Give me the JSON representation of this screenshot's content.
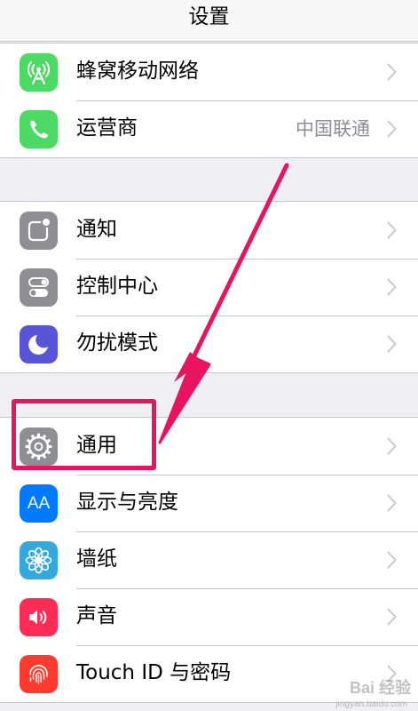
{
  "navbar": {
    "title": "设置"
  },
  "groups": [
    {
      "items": [
        {
          "label": "蜂窝移动网络",
          "icon": "cellular-antenna-icon",
          "icon_color": "#4cd964",
          "value": ""
        },
        {
          "label": "运营商",
          "icon": "phone-icon",
          "icon_color": "#4cd964",
          "value": "中国联通"
        }
      ]
    },
    {
      "items": [
        {
          "label": "通知",
          "icon": "notifications-icon",
          "icon_color": "#8e8e93",
          "value": ""
        },
        {
          "label": "控制中心",
          "icon": "control-center-icon",
          "icon_color": "#8e8e93",
          "value": ""
        },
        {
          "label": "勿扰模式",
          "icon": "moon-icon",
          "icon_color": "#5856d6",
          "value": ""
        }
      ]
    },
    {
      "items": [
        {
          "label": "通用",
          "icon": "gear-icon",
          "icon_color": "#8e8e93",
          "value": ""
        },
        {
          "label": "显示与亮度",
          "icon": "text-size-icon",
          "icon_color": "#007aff",
          "value": ""
        },
        {
          "label": "墙纸",
          "icon": "flower-icon",
          "icon_color": "#34aadc",
          "value": ""
        },
        {
          "label": "声音",
          "icon": "speaker-icon",
          "icon_color": "#ff2d55",
          "value": ""
        },
        {
          "label": "Touch ID 与密码",
          "icon": "fingerprint-icon",
          "icon_color": "#ff3b30",
          "value": ""
        }
      ]
    }
  ],
  "display_icon_text": "AA",
  "annotation": {
    "color": "#e8145e",
    "highlighted_item": "通用"
  },
  "watermark": {
    "text": "Bai 经验",
    "sub": "jingyan.baidu.com"
  }
}
